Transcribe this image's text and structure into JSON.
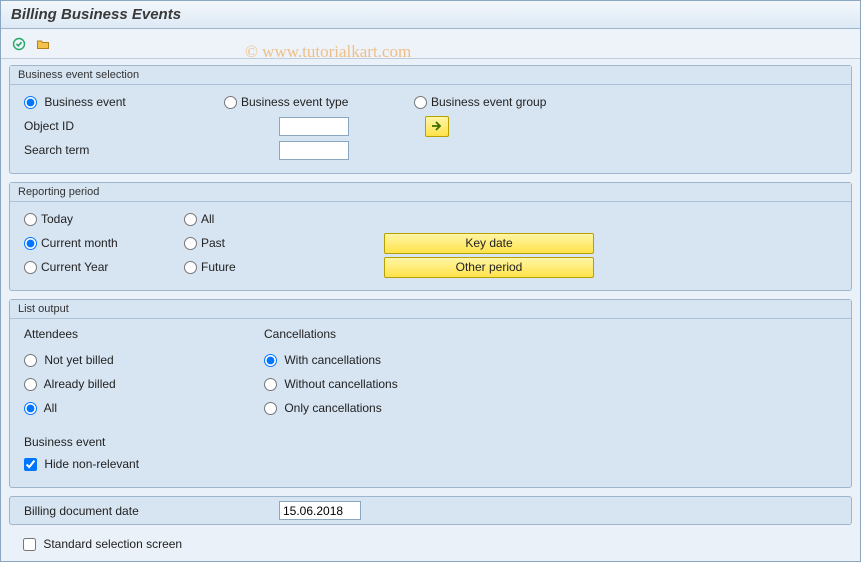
{
  "title": "Billing Business Events",
  "watermark": "© www.tutorialkart.com",
  "group_selection": {
    "legend": "Business event selection",
    "radio_event": "Business event",
    "radio_type": "Business event type",
    "radio_group": "Business event group",
    "object_id_label": "Object ID",
    "object_id_value": "",
    "search_term_label": "Search term",
    "search_term_value": ""
  },
  "group_period": {
    "legend": "Reporting period",
    "today": "Today",
    "all": "All",
    "current_month": "Current month",
    "past": "Past",
    "current_year": "Current Year",
    "future": "Future",
    "btn_keydate": "Key date",
    "btn_other": "Other period"
  },
  "group_output": {
    "legend": "List output",
    "attendees_hdr": "Attendees",
    "not_yet_billed": "Not yet billed",
    "already_billed": "Already billed",
    "all": "All",
    "cancellations_hdr": "Cancellations",
    "with_cancel": "With cancellations",
    "without_cancel": "Without cancellations",
    "only_cancel": "Only cancellations",
    "business_event_hdr": "Business event",
    "hide_nonrelevant": "Hide non-relevant"
  },
  "billing_date": {
    "label": "Billing document date",
    "value": "15.06.2018"
  },
  "std_selection": "Standard selection screen"
}
